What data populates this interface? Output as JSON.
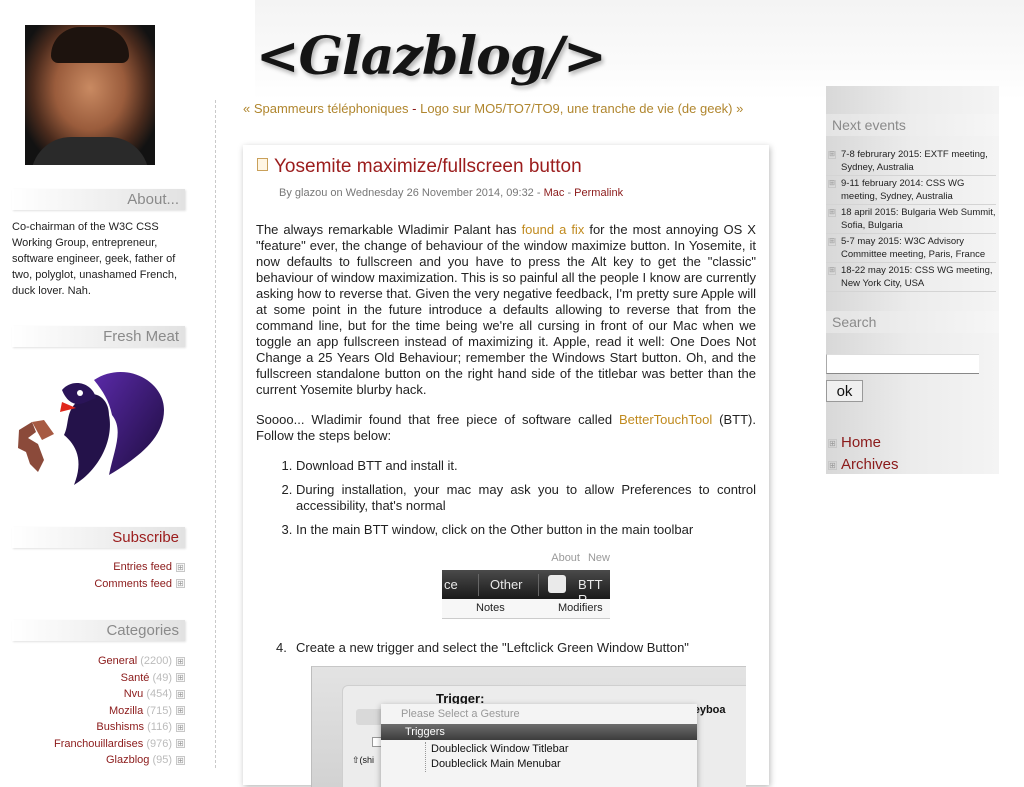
{
  "site": {
    "title": "<Glazblog/>"
  },
  "nav": {
    "prev": "« Spammeurs téléphoniques",
    "separator": "-",
    "next": "Logo sur MO5/TO7/TO9, une tranche de vie (de geek) »"
  },
  "sidebar": {
    "about_heading": "About...",
    "about_text": "Co-chairman of the W3C CSS Working Group, entrepreneur, software engineer, geek, father of two, polyglot, unashamed French, duck lover. Nah.",
    "fresh_meat_heading": "Fresh Meat",
    "subscribe_heading": "Subscribe",
    "feeds": [
      {
        "label": "Entries feed"
      },
      {
        "label": "Comments feed"
      }
    ],
    "categories_heading": "Categories",
    "categories": [
      {
        "name": "General",
        "count": "(2200)"
      },
      {
        "name": "Santé",
        "count": "(49)"
      },
      {
        "name": "Nvu",
        "count": "(454)"
      },
      {
        "name": "Mozilla",
        "count": "(715)"
      },
      {
        "name": "Bushisms",
        "count": "(116)"
      },
      {
        "name": "Franchouillardises",
        "count": "(976)"
      },
      {
        "name": "Glazblog",
        "count": "(95)"
      }
    ]
  },
  "post": {
    "title": "Yosemite maximize/fullscreen button",
    "meta_prefix": "By glazou on Wednesday 26 November 2014, 09:32 -",
    "meta_category": "Mac",
    "meta_sep": "-",
    "meta_permalink": "Permalink",
    "p1_before": "The always remarkable Wladimir Palant has",
    "p1_link": "found a fix",
    "p1_after": "for the most annoying OS X \"feature\" ever, the change of behaviour of the window maximize button. In Yosemite, it now defaults to fullscreen and you have to press the Alt key to get the \"classic\" behaviour of window maximization. This is so painful all the people I know are currently asking how to reverse that. Given the very negative feedback, I'm pretty sure Apple will at some point in the future introduce a defaults allowing to reverse that from the command line, but for the time being we're all cursing in front of our Mac when we toggle an app fullscreen instead of maximizing it. Apple, read it well: One Does Not Change a 25 Years Old Behaviour; remember the Windows Start button. Oh, and the fullscreen standalone button on the right hand side of the titlebar was better than the current Yosemite blurby hack.",
    "p2_before": "Soooo... Wladimir found that free piece of software called",
    "p2_link": "BetterTouchTool",
    "p2_after": "(BTT). Follow the steps below:",
    "steps": [
      "Download BTT and install it.",
      "During installation, your mac may ask you to allow Preferences to control accessibility, that's normal",
      "In the main BTT window, click on the Other button in the main toolbar",
      "Create a new trigger and select the \"Leftclick Green Window Button\""
    ],
    "step4_num": "4.",
    "toolbar_shot": {
      "about": "About",
      "new": "New",
      "ce": "ce",
      "other": "Other",
      "btt": "BTT R",
      "notes": "Notes",
      "modifiers": "Modifiers"
    },
    "trigger_shot": {
      "label": "Trigger:",
      "keyboard": "n Keyboa",
      "placeholder": "Please Select a Gesture",
      "group": "Triggers",
      "item1": "Doubleclick Window Titlebar",
      "item2": "Doubleclick Main Menubar",
      "shift": "⇧(shi"
    }
  },
  "right": {
    "events_heading": "Next events",
    "events": [
      "7-8 februrary 2015: EXTF meeting, Sydney, Australia",
      "9-11 february 2014: CSS WG meeting, Sydney, Australia",
      "18 april 2015: Bulgaria Web Summit, Sofia, Bulgaria",
      "5-7 may 2015: W3C Advisory Committee meeting, Paris, France",
      "18-22 may 2015: CSS WG meeting, New York City, USA"
    ],
    "search_heading": "Search",
    "search_value": "",
    "ok_label": "ok",
    "links": [
      "Home",
      "Archives"
    ]
  },
  "icons": {
    "expand": "⊞",
    "post": "document-icon"
  },
  "colors": {
    "link_red": "#8b1a1a",
    "link_gold": "#c08a1e",
    "title_red": "#9b1c1c"
  }
}
